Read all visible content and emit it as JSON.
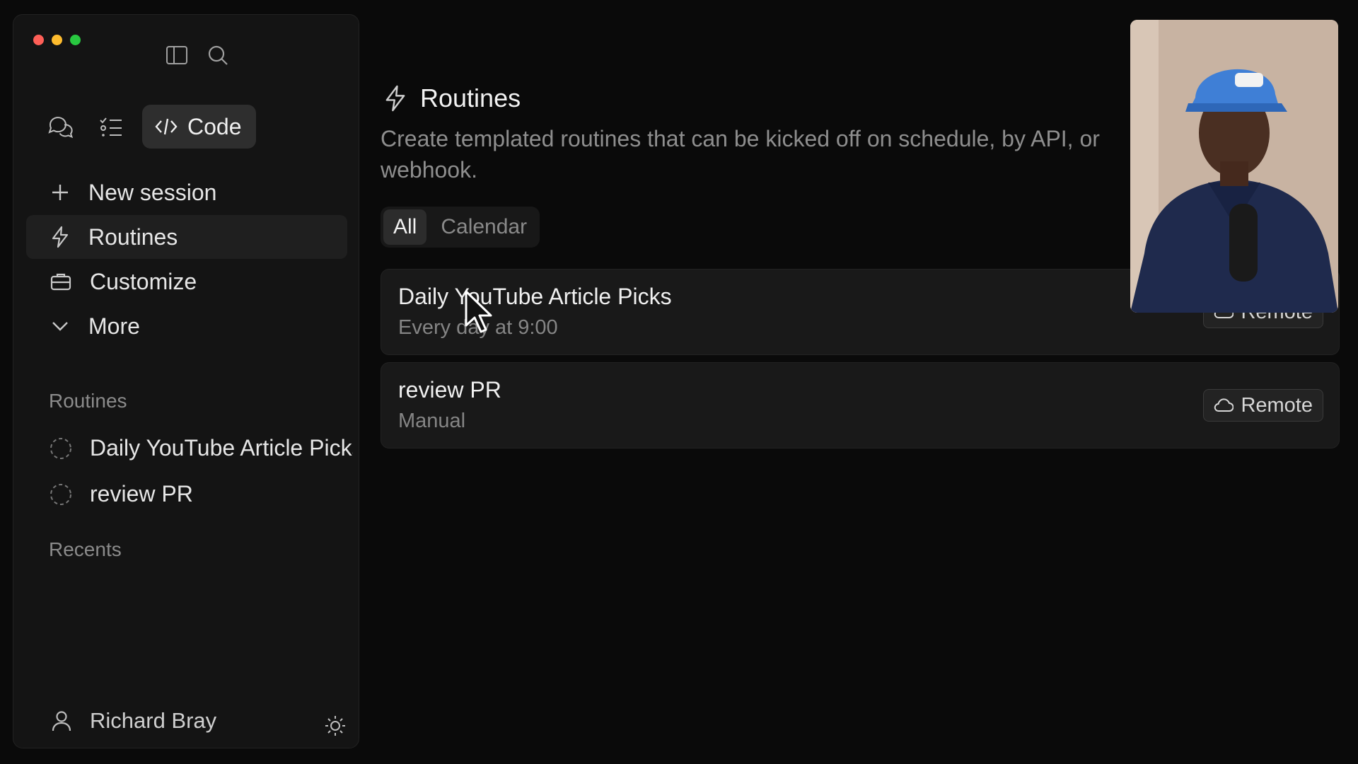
{
  "sidebar": {
    "modes": {
      "code_label": "Code"
    },
    "nav": [
      {
        "label": "New session",
        "icon": "plus-icon"
      },
      {
        "label": "Routines",
        "icon": "lightning-icon",
        "active": true
      },
      {
        "label": "Customize",
        "icon": "briefcase-icon"
      },
      {
        "label": "More",
        "icon": "chevron-down-icon"
      }
    ],
    "routines_heading": "Routines",
    "routines": [
      {
        "label": "Daily YouTube Article Picks"
      },
      {
        "label": "review PR"
      }
    ],
    "recents_heading": "Recents",
    "user": {
      "name": "Richard Bray"
    }
  },
  "main": {
    "title": "Routines",
    "description": "Create templated routines that can be kicked off on schedule, by API, or webhook.",
    "tabs": [
      {
        "label": "All",
        "active": true
      },
      {
        "label": "Calendar",
        "active": false
      }
    ],
    "routines": [
      {
        "name": "Daily YouTube Article Picks",
        "schedule": "Every day at 9:00",
        "badge": "Remote"
      },
      {
        "name": "review PR",
        "schedule": "Manual",
        "badge": "Remote"
      }
    ]
  },
  "colors": {
    "background": "#0a0a0a",
    "sidebar": "#141414",
    "card": "#191919",
    "traffic_red": "#fe5f57",
    "traffic_yellow": "#febc2e",
    "traffic_green": "#28c840"
  }
}
